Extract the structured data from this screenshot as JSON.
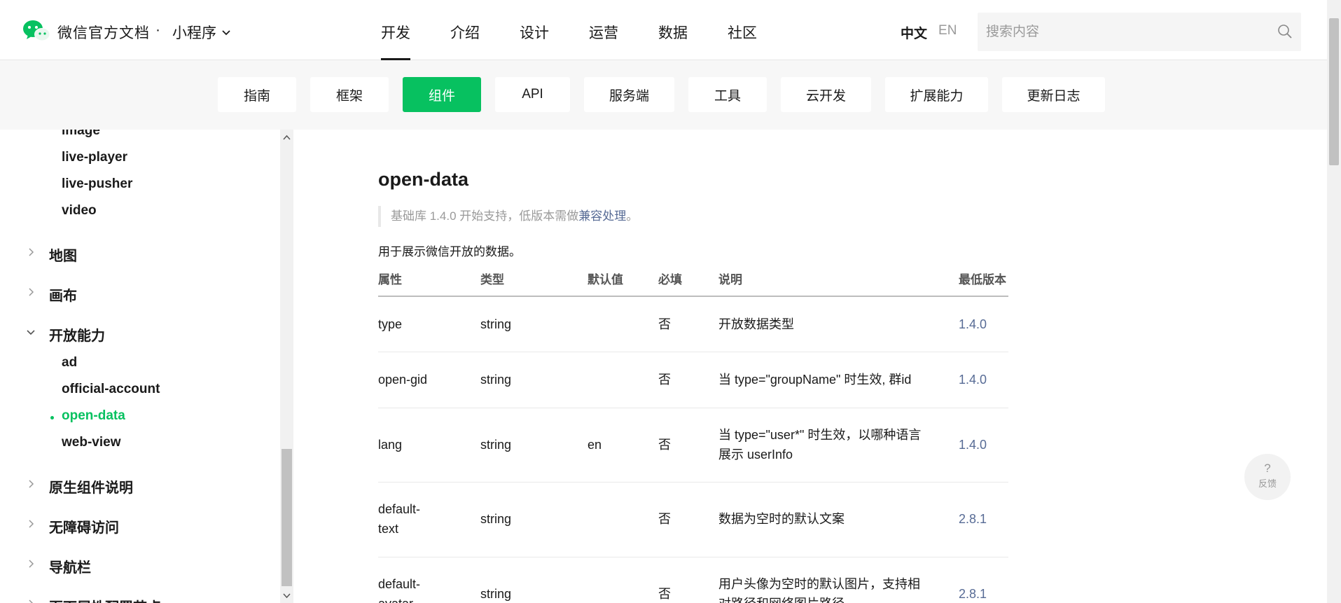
{
  "header": {
    "brand": "微信官方文档",
    "brand_dot": "·",
    "product": "小程序",
    "nav": [
      "开发",
      "介绍",
      "设计",
      "运营",
      "数据",
      "社区"
    ],
    "active_nav": "开发",
    "lang_zh": "中文",
    "lang_en": "EN",
    "search_placeholder": "搜索内容"
  },
  "subnav": {
    "tabs": [
      "指南",
      "框架",
      "组件",
      "API",
      "服务端",
      "工具",
      "云开发",
      "扩展能力",
      "更新日志"
    ],
    "active": "组件"
  },
  "sidebar": {
    "media_items": [
      "image",
      "live-player",
      "live-pusher",
      "video"
    ],
    "group_map": "地图",
    "group_canvas": "画布",
    "group_open": "开放能力",
    "open_items": [
      "ad",
      "official-account",
      "open-data",
      "web-view"
    ],
    "active_item": "open-data",
    "group_native": "原生组件说明",
    "group_a11y": "无障碍访问",
    "group_navbar": "导航栏",
    "group_pagemeta": "页面属性配置节点"
  },
  "content": {
    "title": "open-data",
    "note_prefix": "基础库 1.4.0 开始支持，低版本需做",
    "note_link": "兼容处理",
    "note_suffix": "。",
    "description": "用于展示微信开放的数据。",
    "table": {
      "headers": [
        "属性",
        "类型",
        "默认值",
        "必填",
        "说明",
        "最低版本"
      ],
      "rows": [
        [
          "type",
          "string",
          "",
          "否",
          "开放数据类型",
          "1.4.0"
        ],
        [
          "open-gid",
          "string",
          "",
          "否",
          "当 type=\"groupName\" 时生效, 群id",
          "1.4.0"
        ],
        [
          "lang",
          "string",
          "en",
          "否",
          "当 type=\"user*\" 时生效，以哪种语言展示 userInfo",
          "1.4.0"
        ],
        [
          "default-text",
          "string",
          "",
          "否",
          "数据为空时的默认文案",
          "2.8.1"
        ],
        [
          "default-avatar",
          "string",
          "",
          "否",
          "用户头像为空时的默认图片，支持相对路径和网络图片路径",
          "2.8.1"
        ]
      ]
    }
  },
  "feedback": {
    "icon": "?",
    "label": "反馈"
  },
  "colors": {
    "accent": "#07c160",
    "link": "#576b95"
  }
}
